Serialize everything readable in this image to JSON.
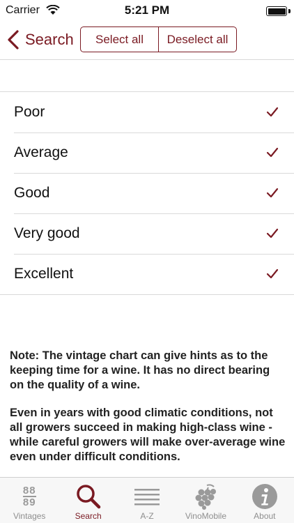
{
  "status_bar": {
    "carrier": "Carrier",
    "time": "5:21 PM",
    "battery_level": 1.0
  },
  "nav": {
    "back_label": "Search",
    "select_all_label": "Select all",
    "deselect_all_label": "Deselect all"
  },
  "options": [
    {
      "label": "Poor",
      "checked": true
    },
    {
      "label": "Average",
      "checked": true
    },
    {
      "label": "Good",
      "checked": true
    },
    {
      "label": "Very good",
      "checked": true
    },
    {
      "label": "Excellent",
      "checked": true
    }
  ],
  "notes": {
    "note1": "Note: The vintage chart can give hints as to the keeping time for a wine. It has no direct bearing on the quality of a wine.",
    "note2": "Even in years with good climatic conditions, not all growers succeed in making high-class wine - while careful growers will make over-average wine even under difficult conditions."
  },
  "tab_bar": {
    "vintage_icon_top": "88",
    "vintage_icon_bottom": "89",
    "tabs": [
      {
        "label": "Vintages",
        "icon": "vintage-chart-icon",
        "active": false
      },
      {
        "label": "Search",
        "icon": "search-icon",
        "active": true
      },
      {
        "label": "A-Z",
        "icon": "list-icon",
        "active": false
      },
      {
        "label": "VinoMobile",
        "icon": "grapes-icon",
        "active": false
      },
      {
        "label": "About",
        "icon": "info-icon",
        "active": false
      }
    ]
  },
  "colors": {
    "accent": "#7a1a22",
    "inactive": "#9a9a9a"
  }
}
